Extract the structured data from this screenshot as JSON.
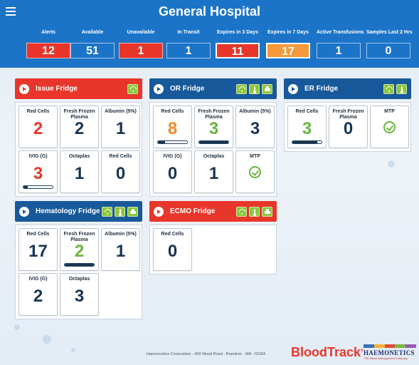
{
  "header": {
    "title": "General Hospital",
    "stats": [
      {
        "label": "Alerts",
        "value": "12",
        "style": "red"
      },
      {
        "label": "Available",
        "value": "51",
        "style": "blue"
      },
      {
        "label": "Unavailable",
        "value": "1",
        "style": "red"
      },
      {
        "label": "In Transit",
        "value": "1",
        "style": "blue"
      },
      {
        "label": "Expires in 3 Days",
        "value": "11",
        "style": "red"
      },
      {
        "label": "Expires in 7 Days",
        "value": "17",
        "style": "orange"
      },
      {
        "label": "Active Transfusions",
        "value": "1",
        "style": "blue"
      },
      {
        "label": "Samples Last 2 Hrs",
        "value": "0",
        "style": "blue"
      }
    ]
  },
  "panels": {
    "issue": {
      "name": "Issue Fridge",
      "tiles": [
        {
          "label": "Red Cells",
          "value": "2",
          "color": "red"
        },
        {
          "label": "Fresh Frozen Plasma",
          "value": "2",
          "color": "navy"
        },
        {
          "label": "Albumin (5%)",
          "value": "1",
          "color": "navy"
        },
        {
          "label": "IVIG (G)",
          "value": "3",
          "color": "red",
          "bar_fill": 0.15
        },
        {
          "label": "Octaplas",
          "value": "1",
          "color": "navy"
        },
        {
          "label": "Red Cells",
          "value": "0",
          "color": "navy"
        }
      ]
    },
    "or": {
      "name": "OR Fridge",
      "tiles": [
        {
          "label": "Red Cells",
          "value": "8",
          "color": "orange",
          "bar_fill": 0.25
        },
        {
          "label": "Fresh Frozen Plasma",
          "value": "3",
          "color": "green",
          "bar_fill": 1
        },
        {
          "label": "Albumin (5%)",
          "value": "3",
          "color": "navy"
        },
        {
          "label": "IVIG (G)",
          "value": "0",
          "color": "navy"
        },
        {
          "label": "Octaplas",
          "value": "1",
          "color": "navy"
        },
        {
          "label": "MTP",
          "check": true
        }
      ]
    },
    "er": {
      "name": "ER Fridge",
      "tiles": [
        {
          "label": "Red Cells",
          "value": "3",
          "color": "green",
          "bar_fill": 0.85
        },
        {
          "label": "Fresh Frozen Plasma",
          "value": "0",
          "color": "navy"
        },
        {
          "label": "MTP",
          "check": true
        }
      ]
    },
    "hematology": {
      "name": "Hematology Fridge",
      "tiles": [
        {
          "label": "Red Cells",
          "value": "17",
          "color": "navy"
        },
        {
          "label": "Fresh Frozen Plasma",
          "value": "2",
          "color": "green",
          "bar_fill": 1
        },
        {
          "label": "Albumin (5%)",
          "value": "1",
          "color": "navy"
        },
        {
          "label": "IVIG (G)",
          "value": "2",
          "color": "navy"
        },
        {
          "label": "Octaplas",
          "value": "3",
          "color": "navy"
        }
      ]
    },
    "ecmo": {
      "name": "ECMO Fridge",
      "tiles": [
        {
          "label": "Red Cells",
          "value": "0",
          "color": "navy"
        }
      ]
    }
  },
  "footer": {
    "address": "Haemonetics Corporation - 400 Wood Road - Braintree - MA - 02184",
    "brand": "BloodTrack",
    "trademark": "®",
    "company": "HAEMONETICS",
    "company_tagline": "THE Blood Management Company"
  },
  "colors": {
    "header_blue": "#1b74c8",
    "alert_red": "#e8362a",
    "warn_orange": "#f59a3a",
    "panel_blue": "#17599a",
    "ok_green": "#6ab43d",
    "icon_green": "#8dc63f"
  }
}
